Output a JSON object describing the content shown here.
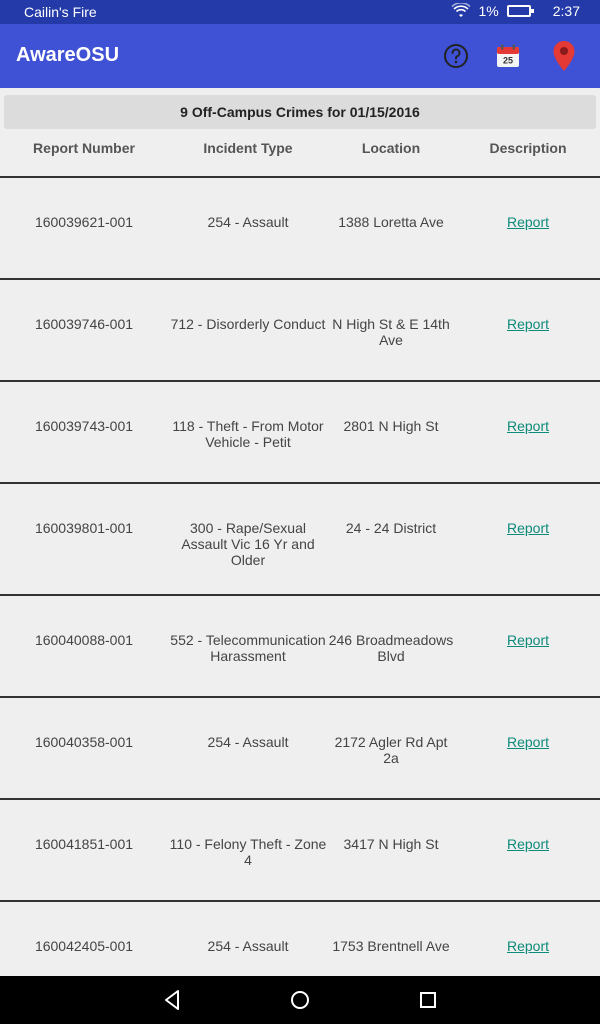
{
  "status_bar": {
    "carrier": "Cailin's Fire",
    "battery": "1%",
    "time": "2:37"
  },
  "app_bar": {
    "title": "AwareOSU",
    "calendar_day": "25",
    "icons": [
      "help-icon",
      "calendar-icon",
      "map-pin-icon"
    ],
    "colors": {
      "primary": "#3f51d5",
      "status": "#243aa8",
      "pin": "#e53935"
    }
  },
  "banner": {
    "text": "9 Off-Campus Crimes for 01/15/2016"
  },
  "columns": [
    "Report Number",
    "Incident Type",
    "Location",
    "Description"
  ],
  "rows": [
    {
      "number": "160039621-001",
      "type": "254 - Assault",
      "location": "1388 Loretta Ave",
      "description": "Report"
    },
    {
      "number": "160039746-001",
      "type": "712 - Disorderly Conduct",
      "location": "N High St & E 14th Ave",
      "description": "Report"
    },
    {
      "number": "160039743-001",
      "type": "118 - Theft - From Motor Vehicle - Petit",
      "location": "2801 N High St",
      "description": "Report"
    },
    {
      "number": "160039801-001",
      "type": "300 - Rape/Sexual Assault Vic 16 Yr and Older",
      "location": "24 - 24 District",
      "description": "Report"
    },
    {
      "number": "160040088-001",
      "type": "552 - Telecommunication Harassment",
      "location": "246 Broadmeadows Blvd",
      "description": "Report"
    },
    {
      "number": "160040358-001",
      "type": "254 - Assault",
      "location": "2172 Agler Rd Apt 2a",
      "description": "Report"
    },
    {
      "number": "160041851-001",
      "type": "110 - Felony Theft - Zone 4",
      "location": "3417 N High St",
      "description": "Report"
    },
    {
      "number": "160042405-001",
      "type": "254 - Assault",
      "location": "1753 Brentnell Ave",
      "description": "Report"
    }
  ],
  "nav": {
    "icons": [
      "back-icon",
      "home-icon",
      "recent-apps-icon"
    ]
  }
}
